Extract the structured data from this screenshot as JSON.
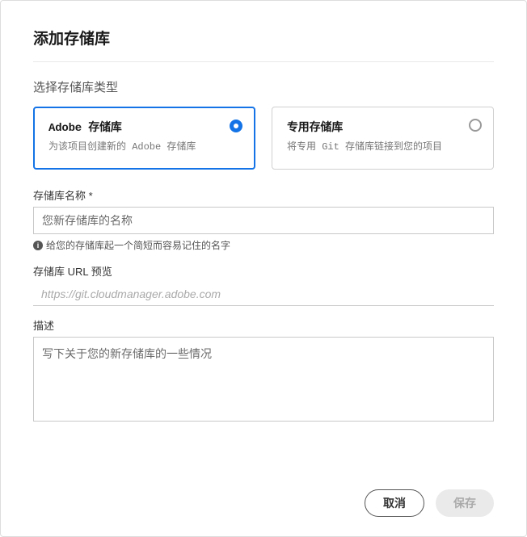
{
  "dialog": {
    "title": "添加存储库",
    "typeLabel": "选择存储库类型",
    "cards": [
      {
        "title": "Adobe 存储库",
        "desc": "为该项目创建新的 Adobe 存储库",
        "selected": true
      },
      {
        "title": "专用存储库",
        "desc": "将专用 Git 存储库链接到您的项目",
        "selected": false
      }
    ],
    "repoName": {
      "label": "存储库名称 *",
      "placeholder": "您新存储库的名称",
      "hint": "给您的存储库起一个简短而容易记住的名字"
    },
    "urlPreview": {
      "label": "存储库 URL 预览",
      "value": "https://git.cloudmanager.adobe.com"
    },
    "description": {
      "label": "描述",
      "placeholder": "写下关于您的新存储库的一些情况"
    },
    "buttons": {
      "cancel": "取消",
      "save": "保存"
    }
  }
}
